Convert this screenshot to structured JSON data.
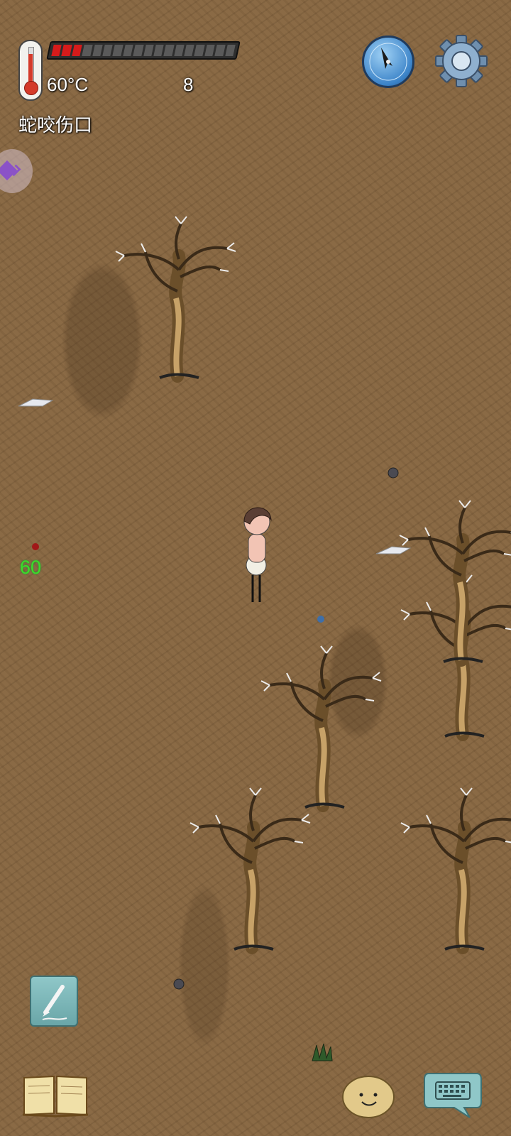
{
  "hud": {
    "temperature": "60°C",
    "day_count": "8",
    "status_effect": "蛇咬伤口",
    "health_segments_total": 18,
    "health_segments_filled": 3,
    "damage_popup": "60"
  },
  "colors": {
    "ground": "#8a6a45",
    "health_fill": "#d61b1b",
    "damage_text": "#3ddc2a",
    "compass": "#3b83c8",
    "button_teal": "#8fc7c8"
  },
  "icons": {
    "thermometer": "thermometer-icon",
    "compass": "compass-icon",
    "settings": "gear-icon",
    "side_tab": "diamond-icon",
    "note": "pencil-icon",
    "journal": "book-icon",
    "pet": "potato-face-icon",
    "chat": "keyboard-icon"
  }
}
